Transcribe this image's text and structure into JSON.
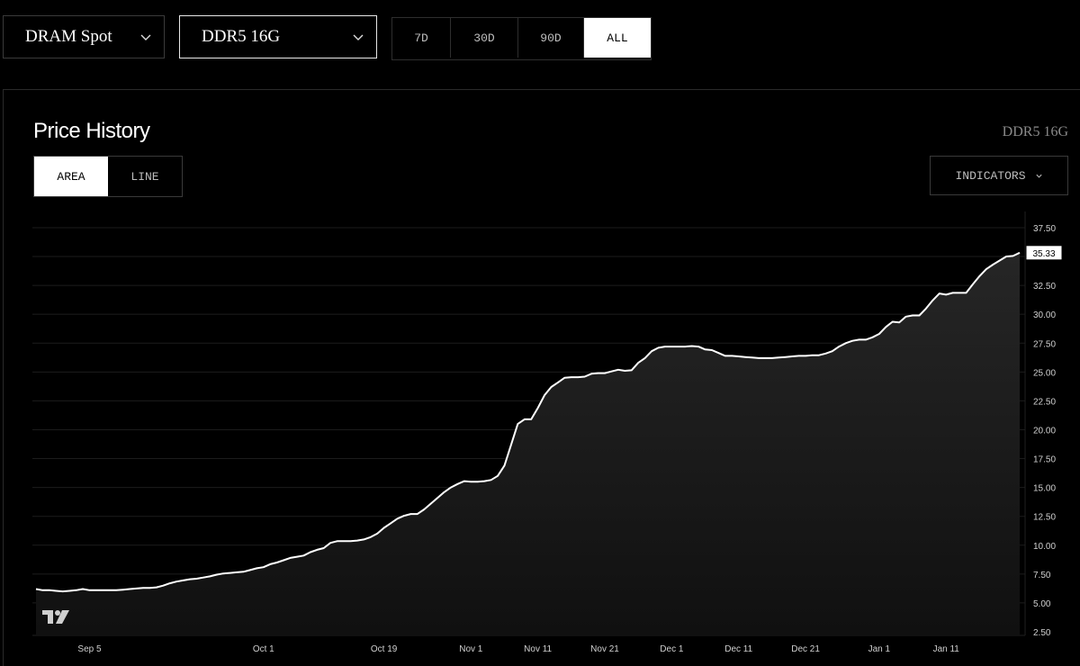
{
  "controls": {
    "market_select": "DRAM Spot",
    "product_select": "DDR5 16G",
    "ranges": [
      {
        "label": "7D",
        "active": false
      },
      {
        "label": "30D",
        "active": false
      },
      {
        "label": "90D",
        "active": false
      },
      {
        "label": "ALL",
        "active": true
      }
    ]
  },
  "card": {
    "title": "Price History",
    "product_label": "DDR5 16G",
    "chart_types": [
      {
        "label": "AREA",
        "active": true
      },
      {
        "label": "LINE",
        "active": false
      }
    ],
    "indicators_label": "INDICATORS"
  },
  "watermark_icon": "tradingview-logo-icon",
  "chart_data": {
    "type": "area",
    "title": "",
    "xlabel": "",
    "ylabel": "",
    "ylim": [
      2.5,
      38.9
    ],
    "y_ticks": [
      2.5,
      5,
      7.5,
      10,
      12.5,
      15,
      17.5,
      20,
      22.5,
      25,
      27.5,
      30,
      32.5,
      35,
      37.5
    ],
    "x_ticks": [
      "Sep 5",
      "Oct 1",
      "Oct 19",
      "Nov 1",
      "Nov 11",
      "Nov 21",
      "Dec 1",
      "Dec 11",
      "Dec 21",
      "Jan 1",
      "Jan 11"
    ],
    "last_value_label": "35.33",
    "colors": {
      "line": "#ffffff",
      "fill": "#1a1a1a",
      "grid": "#1c1c1c"
    },
    "series": [
      {
        "points": [
          [
            "Aug 28",
            6.2
          ],
          [
            "Aug 29",
            6.1
          ],
          [
            "Aug 30",
            6.1
          ],
          [
            "Aug 31",
            6.05
          ],
          [
            "Sep 1",
            6.0
          ],
          [
            "Sep 2",
            6.05
          ],
          [
            "Sep 3",
            6.1
          ],
          [
            "Sep 4",
            6.2
          ],
          [
            "Sep 5",
            6.1
          ],
          [
            "Sep 6",
            6.1
          ],
          [
            "Sep 7",
            6.1
          ],
          [
            "Sep 8",
            6.1
          ],
          [
            "Sep 9",
            6.1
          ],
          [
            "Sep 10",
            6.15
          ],
          [
            "Sep 11",
            6.2
          ],
          [
            "Sep 12",
            6.25
          ],
          [
            "Sep 13",
            6.3
          ],
          [
            "Sep 14",
            6.3
          ],
          [
            "Sep 15",
            6.35
          ],
          [
            "Sep 16",
            6.5
          ],
          [
            "Sep 17",
            6.7
          ],
          [
            "Sep 18",
            6.85
          ],
          [
            "Sep 19",
            6.95
          ],
          [
            "Sep 20",
            7.05
          ],
          [
            "Sep 21",
            7.1
          ],
          [
            "Sep 22",
            7.2
          ],
          [
            "Sep 23",
            7.3
          ],
          [
            "Sep 24",
            7.45
          ],
          [
            "Sep 25",
            7.55
          ],
          [
            "Sep 26",
            7.6
          ],
          [
            "Sep 27",
            7.65
          ],
          [
            "Sep 28",
            7.7
          ],
          [
            "Sep 29",
            7.85
          ],
          [
            "Sep 30",
            8.0
          ],
          [
            "Oct 1",
            8.1
          ],
          [
            "Oct 2",
            8.35
          ],
          [
            "Oct 3",
            8.5
          ],
          [
            "Oct 4",
            8.7
          ],
          [
            "Oct 5",
            8.9
          ],
          [
            "Oct 6",
            9.0
          ],
          [
            "Oct 7",
            9.1
          ],
          [
            "Oct 8",
            9.4
          ],
          [
            "Oct 9",
            9.6
          ],
          [
            "Oct 10",
            9.75
          ],
          [
            "Oct 11",
            10.2
          ],
          [
            "Oct 12",
            10.35
          ],
          [
            "Oct 13",
            10.35
          ],
          [
            "Oct 14",
            10.35
          ],
          [
            "Oct 15",
            10.4
          ],
          [
            "Oct 16",
            10.5
          ],
          [
            "Oct 17",
            10.7
          ],
          [
            "Oct 18",
            11.0
          ],
          [
            "Oct 19",
            11.5
          ],
          [
            "Oct 20",
            11.9
          ],
          [
            "Oct 21",
            12.3
          ],
          [
            "Oct 22",
            12.55
          ],
          [
            "Oct 23",
            12.7
          ],
          [
            "Oct 24",
            12.7
          ],
          [
            "Oct 25",
            13.1
          ],
          [
            "Oct 26",
            13.6
          ],
          [
            "Oct 27",
            14.1
          ],
          [
            "Oct 28",
            14.6
          ],
          [
            "Oct 29",
            15.0
          ],
          [
            "Oct 30",
            15.3
          ],
          [
            "Oct 31",
            15.55
          ],
          [
            "Nov 1",
            15.5
          ],
          [
            "Nov 2",
            15.5
          ],
          [
            "Nov 3",
            15.55
          ],
          [
            "Nov 4",
            15.65
          ],
          [
            "Nov 5",
            16.0
          ],
          [
            "Nov 6",
            16.9
          ],
          [
            "Nov 7",
            18.7
          ],
          [
            "Nov 8",
            20.5
          ],
          [
            "Nov 9",
            20.9
          ],
          [
            "Nov 10",
            20.9
          ],
          [
            "Nov 11",
            21.9
          ],
          [
            "Nov 12",
            23.0
          ],
          [
            "Nov 13",
            23.7
          ],
          [
            "Nov 14",
            24.1
          ],
          [
            "Nov 15",
            24.5
          ],
          [
            "Nov 16",
            24.55
          ],
          [
            "Nov 17",
            24.55
          ],
          [
            "Nov 18",
            24.6
          ],
          [
            "Nov 19",
            24.85
          ],
          [
            "Nov 20",
            24.9
          ],
          [
            "Nov 21",
            24.9
          ],
          [
            "Nov 22",
            25.05
          ],
          [
            "Nov 23",
            25.2
          ],
          [
            "Nov 24",
            25.1
          ],
          [
            "Nov 25",
            25.15
          ],
          [
            "Nov 26",
            25.8
          ],
          [
            "Nov 27",
            26.2
          ],
          [
            "Nov 28",
            26.8
          ],
          [
            "Nov 29",
            27.1
          ],
          [
            "Nov 30",
            27.2
          ],
          [
            "Dec 1",
            27.2
          ],
          [
            "Dec 2",
            27.2
          ],
          [
            "Dec 3",
            27.2
          ],
          [
            "Dec 4",
            27.25
          ],
          [
            "Dec 5",
            27.2
          ],
          [
            "Dec 6",
            26.95
          ],
          [
            "Dec 7",
            26.9
          ],
          [
            "Dec 8",
            26.65
          ],
          [
            "Dec 9",
            26.4
          ],
          [
            "Dec 10",
            26.4
          ],
          [
            "Dec 11",
            26.35
          ],
          [
            "Dec 12",
            26.3
          ],
          [
            "Dec 13",
            26.25
          ],
          [
            "Dec 14",
            26.2
          ],
          [
            "Dec 15",
            26.2
          ],
          [
            "Dec 16",
            26.2
          ],
          [
            "Dec 17",
            26.25
          ],
          [
            "Dec 18",
            26.3
          ],
          [
            "Dec 19",
            26.35
          ],
          [
            "Dec 20",
            26.4
          ],
          [
            "Dec 21",
            26.4
          ],
          [
            "Dec 22",
            26.45
          ],
          [
            "Dec 23",
            26.45
          ],
          [
            "Dec 24",
            26.6
          ],
          [
            "Dec 25",
            26.8
          ],
          [
            "Dec 26",
            27.2
          ],
          [
            "Dec 27",
            27.5
          ],
          [
            "Dec 28",
            27.7
          ],
          [
            "Dec 29",
            27.8
          ],
          [
            "Dec 30",
            27.8
          ],
          [
            "Dec 31",
            28.0
          ],
          [
            "Jan 1",
            28.3
          ],
          [
            "Jan 2",
            28.9
          ],
          [
            "Jan 3",
            29.35
          ],
          [
            "Jan 4",
            29.3
          ],
          [
            "Jan 5",
            29.8
          ],
          [
            "Jan 6",
            29.9
          ],
          [
            "Jan 7",
            29.9
          ],
          [
            "Jan 8",
            30.5
          ],
          [
            "Jan 9",
            31.2
          ],
          [
            "Jan 10",
            31.8
          ],
          [
            "Jan 11",
            31.7
          ],
          [
            "Jan 12",
            31.85
          ],
          [
            "Jan 13",
            31.85
          ],
          [
            "Jan 14",
            31.85
          ],
          [
            "Jan 15",
            32.6
          ],
          [
            "Jan 16",
            33.3
          ],
          [
            "Jan 17",
            33.9
          ],
          [
            "Jan 18",
            34.3
          ],
          [
            "Jan 19",
            34.65
          ],
          [
            "Jan 20",
            35.0
          ],
          [
            "Jan 21",
            35.05
          ],
          [
            "Jan 22",
            35.33
          ]
        ]
      }
    ]
  }
}
